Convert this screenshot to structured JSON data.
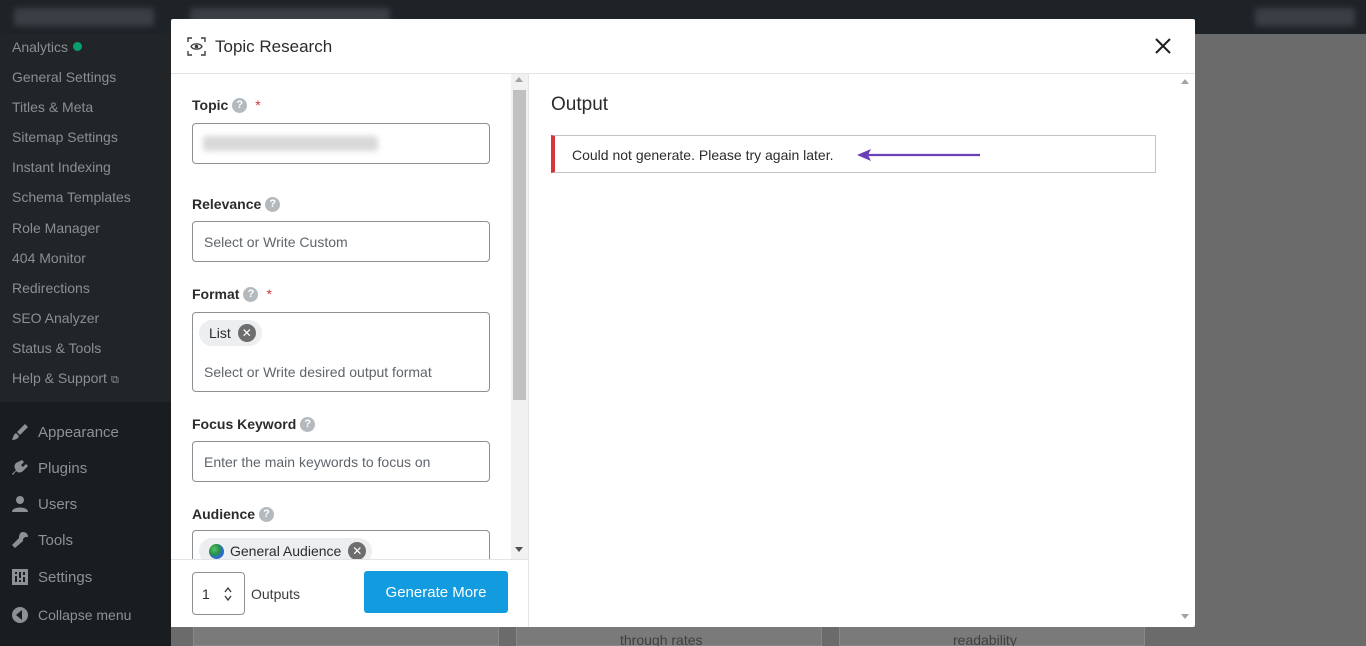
{
  "sidebar": {
    "submenu": [
      {
        "label": "Analytics",
        "status_dot": true
      },
      {
        "label": "General Settings"
      },
      {
        "label": "Titles & Meta"
      },
      {
        "label": "Sitemap Settings"
      },
      {
        "label": "Instant Indexing"
      },
      {
        "label": "Schema Templates"
      },
      {
        "label": "Role Manager"
      },
      {
        "label": "404 Monitor"
      },
      {
        "label": "Redirections"
      },
      {
        "label": "SEO Analyzer"
      },
      {
        "label": "Status & Tools"
      },
      {
        "label": "Help & Support",
        "external": true
      }
    ],
    "menu": [
      {
        "label": "Appearance",
        "icon": "paintbrush-icon"
      },
      {
        "label": "Plugins",
        "icon": "plugin-icon"
      },
      {
        "label": "Users",
        "icon": "user-icon"
      },
      {
        "label": "Tools",
        "icon": "wrench-icon"
      },
      {
        "label": "Settings",
        "icon": "settings-icon"
      },
      {
        "label": "Collapse menu",
        "icon": "collapse-icon"
      }
    ]
  },
  "background": {
    "card_texts": [
      "through rates",
      "readability"
    ]
  },
  "modal": {
    "title": "Topic Research",
    "icon": "eye-scan-icon",
    "form": {
      "topic": {
        "label": "Topic",
        "required_mark": "*"
      },
      "relevance": {
        "label": "Relevance",
        "placeholder": "Select or Write Custom"
      },
      "format": {
        "label": "Format",
        "required_mark": "*",
        "chip": "List",
        "placeholder": "Select or Write desired output format"
      },
      "focus_keyword": {
        "label": "Focus Keyword",
        "placeholder": "Enter the main keywords to focus on"
      },
      "audience": {
        "label": "Audience",
        "chip": "General Audience"
      }
    },
    "help_glyph": "?",
    "chip_remove_glyph": "✕",
    "footer": {
      "outputs_value": "1",
      "outputs_label": "Outputs",
      "generate_button": "Generate More"
    },
    "output": {
      "title": "Output",
      "error_message": "Could not generate. Please try again later."
    },
    "colors": {
      "primary_button": "#139be0",
      "error_border": "#d63638",
      "annotation_arrow": "#6b3fb8",
      "required": "#d63638"
    }
  }
}
